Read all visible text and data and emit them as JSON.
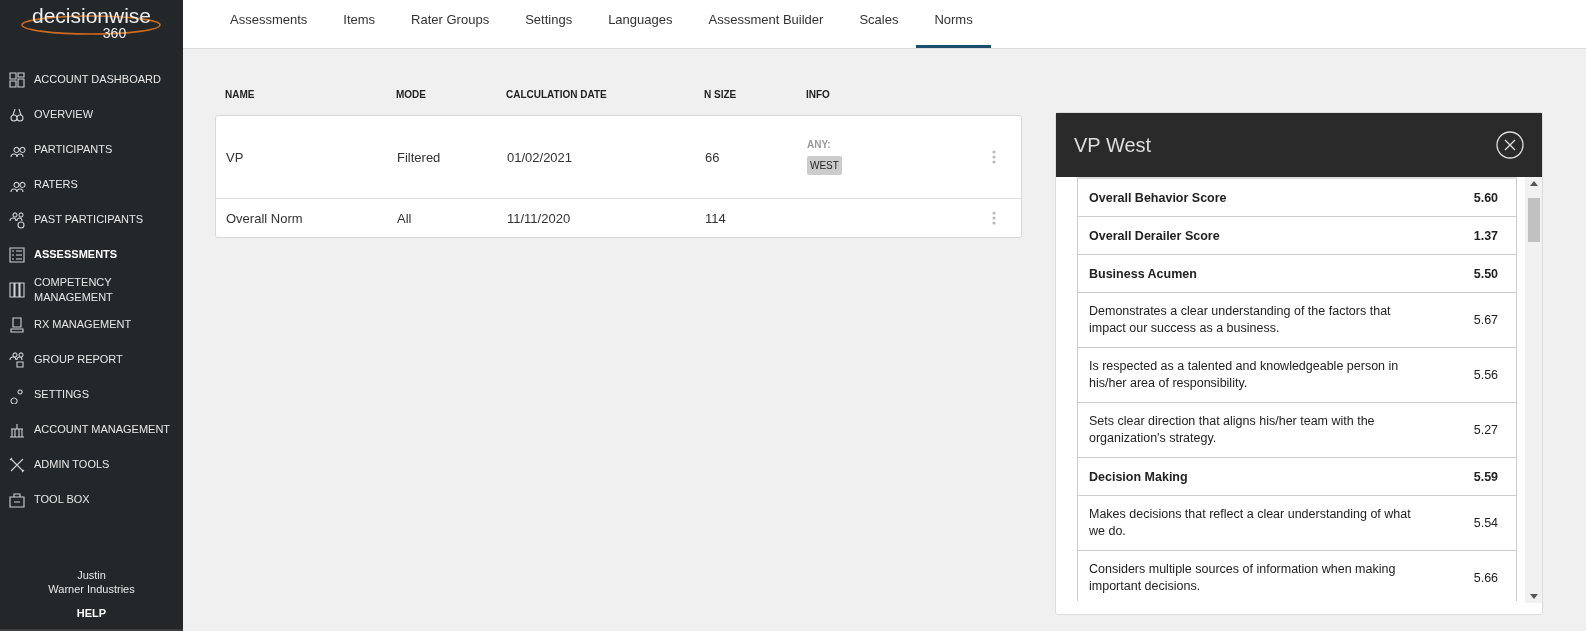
{
  "logo": {
    "word": "decisionwise",
    "number": "360"
  },
  "sidebar": {
    "items": [
      {
        "label": "ACCOUNT DASHBOARD",
        "selected": false
      },
      {
        "label": "OVERVIEW",
        "selected": false
      },
      {
        "label": "PARTICIPANTS",
        "selected": false
      },
      {
        "label": "RATERS",
        "selected": false
      },
      {
        "label": "PAST PARTICIPANTS",
        "selected": false
      },
      {
        "label": "ASSESSMENTS",
        "selected": true
      },
      {
        "label": "COMPETENCY MANAGEMENT",
        "selected": false
      },
      {
        "label": "RX MANAGEMENT",
        "selected": false
      },
      {
        "label": "GROUP REPORT",
        "selected": false
      },
      {
        "label": "SETTINGS",
        "selected": false
      },
      {
        "label": "ACCOUNT MANAGEMENT",
        "selected": false
      },
      {
        "label": "ADMIN TOOLS",
        "selected": false
      },
      {
        "label": "TOOL BOX",
        "selected": false
      }
    ],
    "user_name": "Justin",
    "company": "Warner Industries",
    "help": "HELP"
  },
  "tabs": [
    {
      "label": "Assessments",
      "selected": false
    },
    {
      "label": "Items",
      "selected": false
    },
    {
      "label": "Rater Groups",
      "selected": false
    },
    {
      "label": "Settings",
      "selected": false
    },
    {
      "label": "Languages",
      "selected": false
    },
    {
      "label": "Assessment Builder",
      "selected": false
    },
    {
      "label": "Scales",
      "selected": false
    },
    {
      "label": "Norms",
      "selected": true
    }
  ],
  "table": {
    "columns": [
      "NAME",
      "MODE",
      "CALCULATION DATE",
      "N SIZE",
      "INFO"
    ],
    "rows": [
      {
        "name": "VP",
        "mode": "Filtered",
        "date": "01/02/2021",
        "n_size": "66",
        "info_label": "ANY:",
        "info_tags": [
          "WEST"
        ]
      },
      {
        "name": "Overall Norm",
        "mode": "All",
        "date": "11/11/2020",
        "n_size": "114",
        "info_tags": []
      }
    ]
  },
  "panel": {
    "title": "VP West",
    "scores": [
      {
        "kind": "section",
        "label": "Overall Behavior Score",
        "value": "5.60"
      },
      {
        "kind": "section",
        "label": "Overall Derailer Score",
        "value": "1.37"
      },
      {
        "kind": "section",
        "label": "Business Acumen",
        "value": "5.50"
      },
      {
        "kind": "item",
        "label": "Demonstrates a clear understanding of the factors that impact our success as a business.",
        "value": "5.67"
      },
      {
        "kind": "item",
        "label": "Is respected as a talented and knowledgeable person in his/her area of responsibility.",
        "value": "5.56"
      },
      {
        "kind": "item",
        "label": "Sets clear direction that aligns his/her team with the organization's strategy.",
        "value": "5.27"
      },
      {
        "kind": "section",
        "label": "Decision Making",
        "value": "5.59"
      },
      {
        "kind": "item",
        "label": "Makes decisions that reflect a clear understanding of what we do.",
        "value": "5.54"
      },
      {
        "kind": "item",
        "label": "Considers multiple sources of information when making important decisions.",
        "value": "5.66"
      }
    ]
  }
}
